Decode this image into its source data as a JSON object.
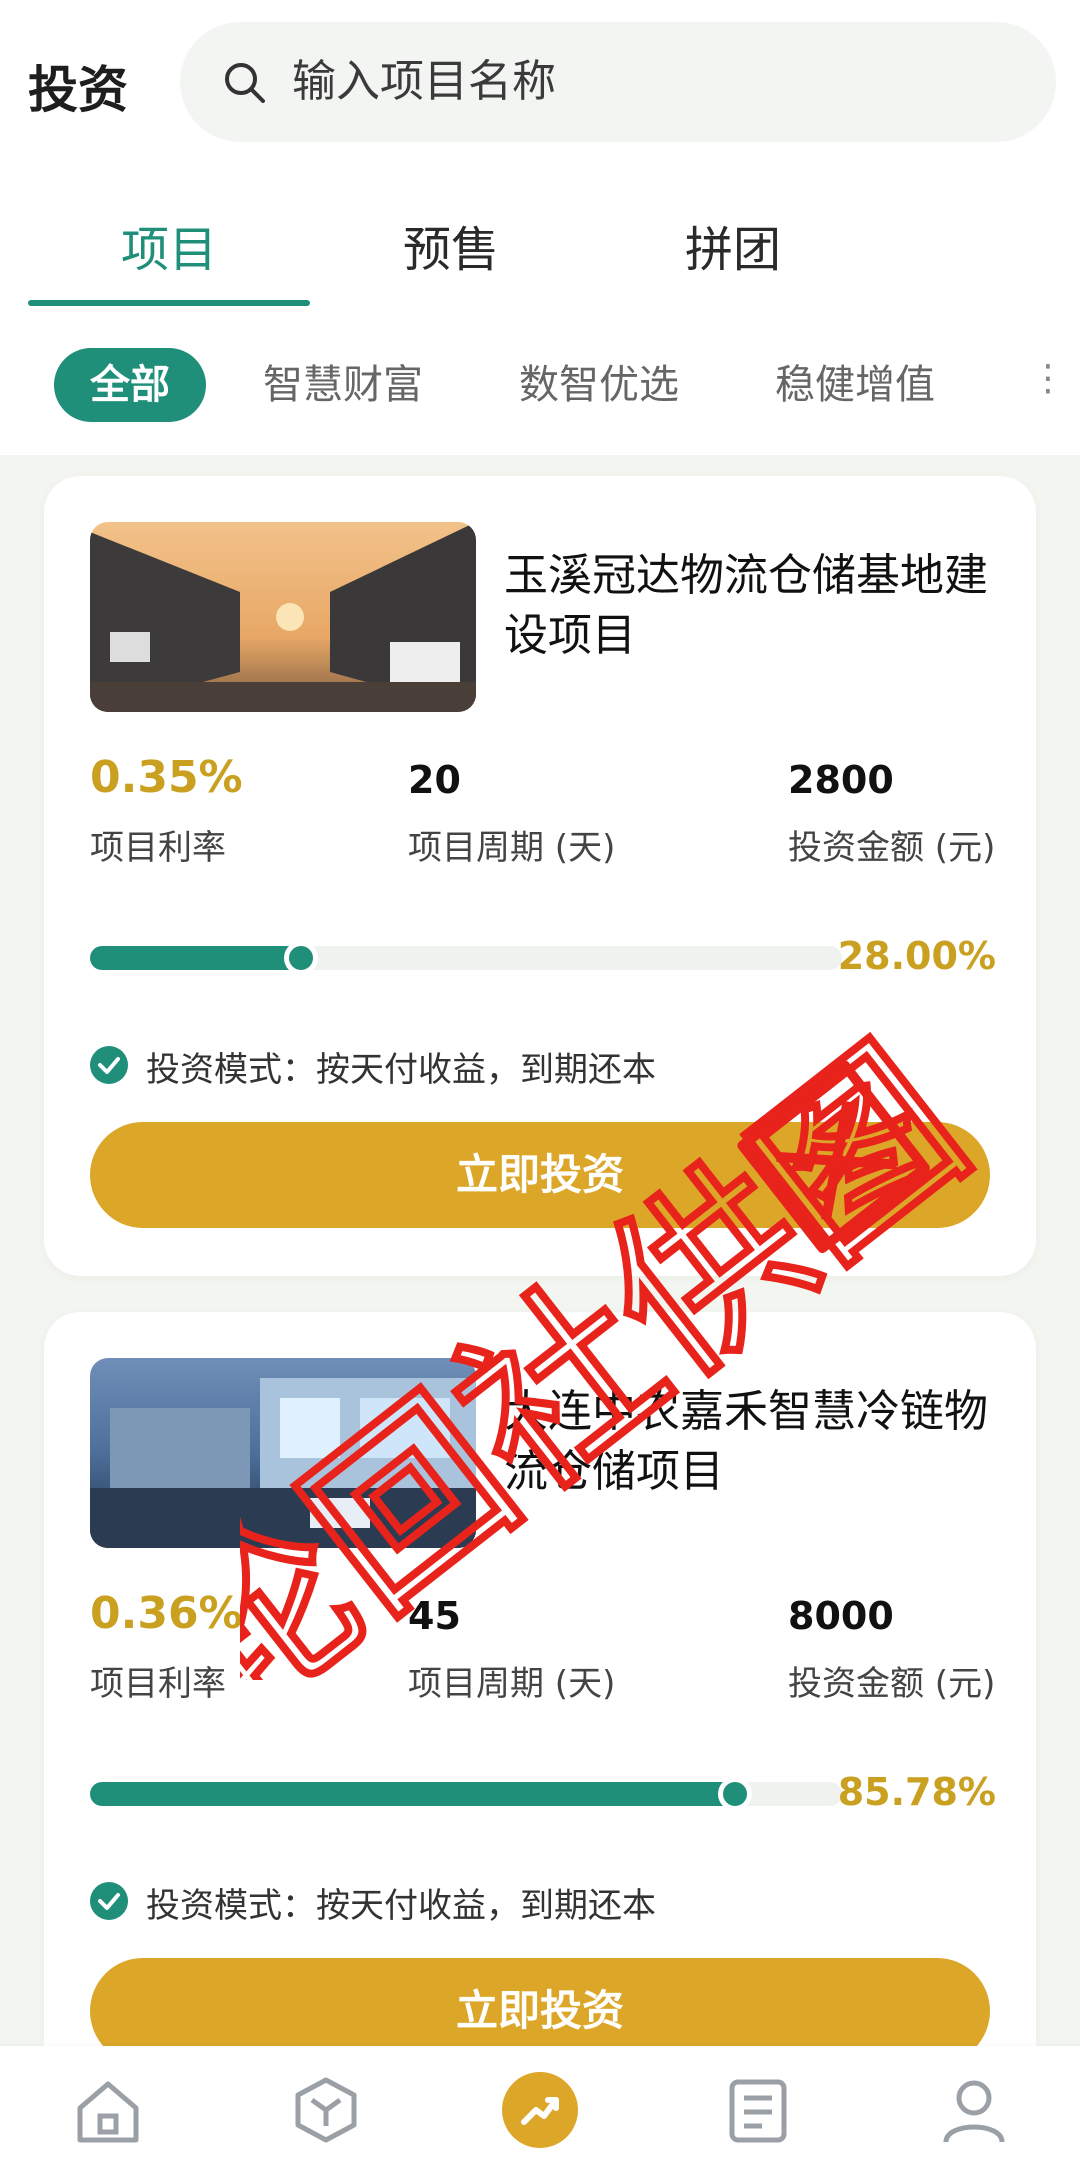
{
  "header": {
    "title": "投资",
    "search_placeholder": "输入项目名称"
  },
  "tabs": [
    {
      "label": "项目",
      "active": true
    },
    {
      "label": "预售",
      "active": false
    },
    {
      "label": "拼团",
      "active": false
    }
  ],
  "categories": [
    {
      "label": "全部",
      "active": true
    },
    {
      "label": "智慧财富",
      "active": false
    },
    {
      "label": "数智优选",
      "active": false
    },
    {
      "label": "稳健增值",
      "active": false
    }
  ],
  "projects": [
    {
      "title": "玉溪冠达物流仓储基地建设项目",
      "rate": "0.35%",
      "rate_label": "项目利率",
      "period": "20",
      "period_label": "项目周期 (天)",
      "amount": "2800",
      "amount_label": "投资金额 (元)",
      "progress": 0.28,
      "progress_text": "28.00%",
      "mode": "投资模式：按天付收益，到期还本",
      "button": "立即投资"
    },
    {
      "title": "大连中农嘉禾智慧冷链物流仓储项目",
      "rate": "0.36%",
      "rate_label": "项目利率",
      "period": "45",
      "period_label": "项目周期 (天)",
      "amount": "8000",
      "amount_label": "投资金额 (元)",
      "progress": 0.8578,
      "progress_text": "85.78%",
      "mode": "投资模式：按天付收益，到期还本",
      "button": "立即投资"
    }
  ],
  "watermark": "轮回社供图",
  "bottom_nav": [
    {
      "icon": "home-icon",
      "active": false
    },
    {
      "icon": "cube-icon",
      "active": false
    },
    {
      "icon": "invest-trend-icon",
      "active": true
    },
    {
      "icon": "news-icon",
      "active": false
    },
    {
      "icon": "profile-icon",
      "active": false
    }
  ],
  "colors": {
    "accent": "#1f8f7a",
    "gold": "#dca629",
    "rate": "#c9a020",
    "watermark": "#e8231b"
  }
}
